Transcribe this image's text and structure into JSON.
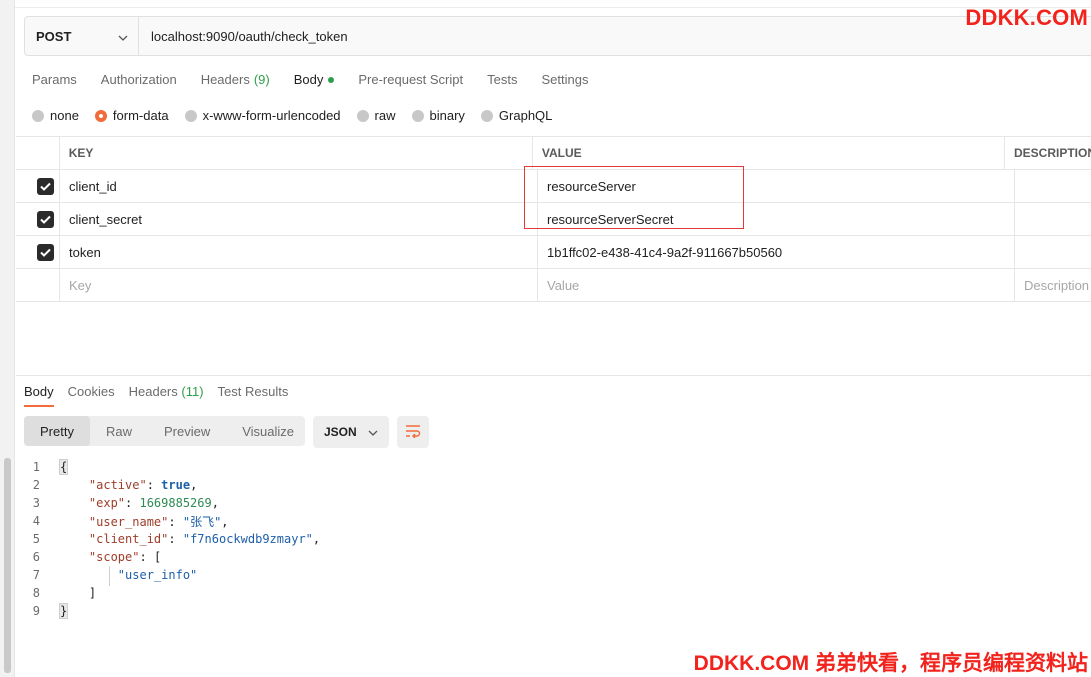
{
  "request": {
    "method": "POST",
    "url": "localhost:9090/oauth/check_token"
  },
  "watermark": {
    "top": "DDKK.COM",
    "bottom": "DDKK.COM 弟弟快看，程序员编程资料站"
  },
  "request_tabs": {
    "params": "Params",
    "authorization": "Authorization",
    "headers": "Headers",
    "headers_count": "(9)",
    "body": "Body",
    "pre_request": "Pre-request Script",
    "tests": "Tests",
    "settings": "Settings"
  },
  "body_types": {
    "none": "none",
    "form_data": "form-data",
    "urlencoded": "x-www-form-urlencoded",
    "raw": "raw",
    "binary": "binary",
    "graphql": "GraphQL",
    "selected": "form-data"
  },
  "params_table": {
    "headers": {
      "key": "KEY",
      "value": "VALUE",
      "description": "DESCRIPTION"
    },
    "rows": [
      {
        "key": "client_id",
        "value": "resourceServer",
        "checked": true
      },
      {
        "key": "client_secret",
        "value": "resourceServerSecret",
        "checked": true
      },
      {
        "key": "token",
        "value": "1b1ffc02-e438-41c4-9a2f-911667b50560",
        "checked": true
      }
    ],
    "placeholders": {
      "key": "Key",
      "value": "Value",
      "description": "Description"
    }
  },
  "response_tabs": {
    "body": "Body",
    "cookies": "Cookies",
    "headers": "Headers",
    "headers_count": "(11)",
    "test_results": "Test Results"
  },
  "view_modes": {
    "pretty": "Pretty",
    "raw": "Raw",
    "preview": "Preview",
    "visualize": "Visualize",
    "format": "JSON"
  },
  "response_code": {
    "line_numbers": [
      "1",
      "2",
      "3",
      "4",
      "5",
      "6",
      "7",
      "8",
      "9"
    ],
    "open_brace": "{",
    "close_brace": "}",
    "active_key": "\"active\"",
    "active_val": "true",
    "exp_key": "\"exp\"",
    "exp_val": "1669885269",
    "user_name_key": "\"user_name\"",
    "user_name_val": "\"张飞\"",
    "client_id_key": "\"client_id\"",
    "client_id_val": "\"f7n6ockwdb9zmayr\"",
    "scope_key": "\"scope\"",
    "scope_open": "[",
    "scope_item": "\"user_info\"",
    "scope_close": "]"
  },
  "colors": {
    "accent": "#f26b3a",
    "highlight_box": "#e53935",
    "watermark": "#f2221c",
    "count_green": "#2e9e4a"
  }
}
